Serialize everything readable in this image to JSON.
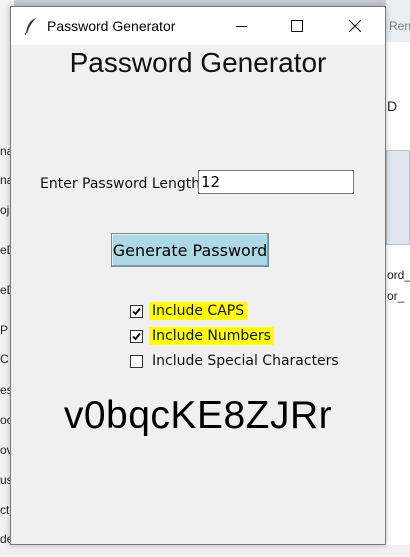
{
  "window": {
    "title": "Password Generator"
  },
  "heading": "Password Generator",
  "length_field": {
    "label": "Enter Password Length",
    "value": "12"
  },
  "generate_button": {
    "label": "Generate Password",
    "color": "#add8e6"
  },
  "options": [
    {
      "label": "Include CAPS",
      "checked": true,
      "highlighted": true
    },
    {
      "label": "Include Numbers",
      "checked": true,
      "highlighted": true
    },
    {
      "label": "Include Special Characters",
      "checked": false,
      "highlighted": false
    }
  ],
  "generated_password": "v0bqcKE8ZJRr",
  "highlight_color": "#ffff00",
  "icons": [
    "feather-icon",
    "minimize-icon",
    "maximize-icon",
    "close-icon",
    "checkmark-icon"
  ],
  "background": {
    "left_fragments": [
      "na",
      "na",
      "oj",
      "eD",
      "eD",
      "P",
      "C",
      "es",
      "oc",
      "ov",
      "us",
      "ct",
      "de"
    ],
    "right_tab": "Rena",
    "right_fragments": [
      "D",
      "ord_",
      "or_"
    ]
  }
}
